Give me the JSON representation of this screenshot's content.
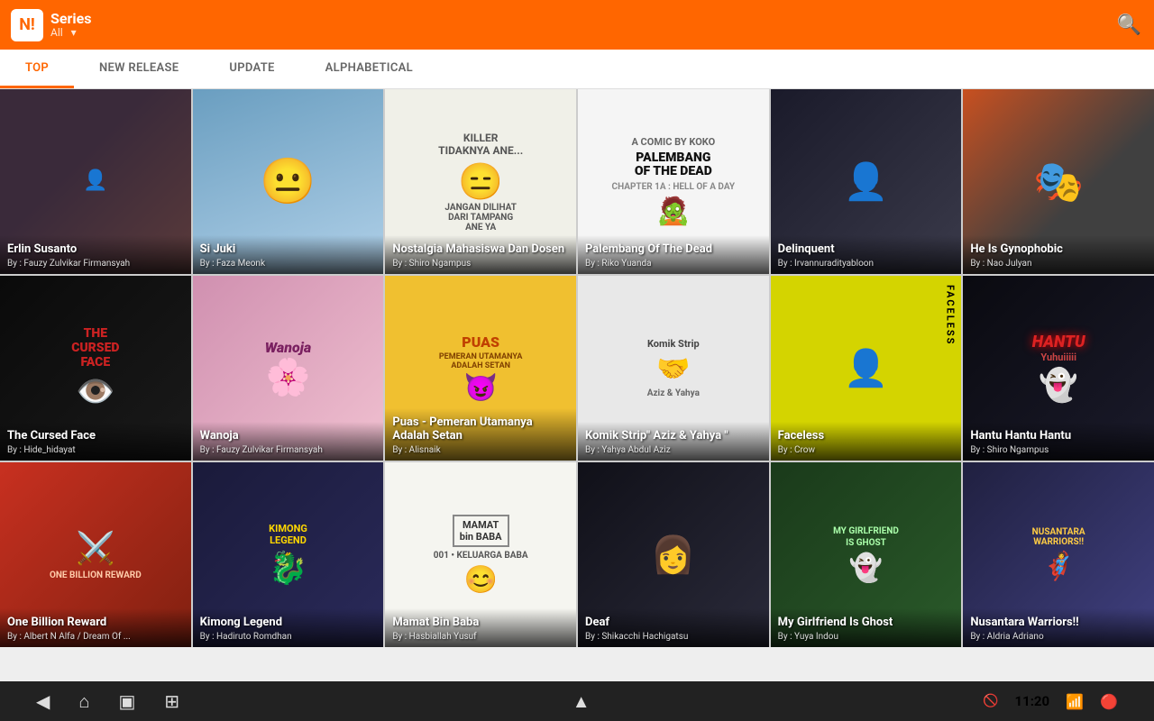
{
  "header": {
    "logo": "N!",
    "series_label": "Series",
    "all_label": "All"
  },
  "tabs": [
    {
      "label": "TOP",
      "active": true
    },
    {
      "label": "NEW RELEASE",
      "active": false
    },
    {
      "label": "UPDATE",
      "active": false
    },
    {
      "label": "ALPHABETICAL",
      "active": false
    }
  ],
  "manga_grid": [
    {
      "row": 1,
      "items": [
        {
          "title": "Erlin Susanto",
          "author": "By : Fauzy Zulvikar Firmansyah",
          "theme": "card-erlin"
        },
        {
          "title": "Si Juki",
          "author": "By : Faza Meonk",
          "theme": "card-sijuki"
        },
        {
          "title": "Nostalgia Mahasiswa Dan Dosen",
          "author": "By : Shiro Ngampus",
          "theme": "card-nostalgia"
        },
        {
          "title": "Palembang Of The Dead",
          "author": "By : Riko Yuanda",
          "theme": "card-palembang"
        },
        {
          "title": "Delinquent",
          "author": "By : Irvannuradityabloon",
          "theme": "card-delinquent"
        },
        {
          "title": "He Is Gynophobic",
          "author": "By : Nao Julyan",
          "theme": "card-gynophobic"
        }
      ]
    },
    {
      "row": 2,
      "items": [
        {
          "title": "The Cursed Face",
          "author": "By : Hide_hidayat",
          "theme": "card-cursed"
        },
        {
          "title": "Wanoja",
          "author": "By : Fauzy Zulvikar Firmansyah",
          "theme": "card-wanoja"
        },
        {
          "title": "Puas - Pemeran Utamanya Adalah Setan",
          "author": "By : Alisnaik",
          "theme": "card-puas"
        },
        {
          "title": "Komik Strip\" Aziz & Yahya \"",
          "author": "By : Yahya Abdul Aziz",
          "theme": "card-komik"
        },
        {
          "title": "Faceless",
          "author": "By : Crow",
          "theme": "card-faceless"
        },
        {
          "title": "Hantu Hantu Hantu",
          "author": "By : Shiro Ngampus",
          "theme": "card-hantu"
        }
      ]
    },
    {
      "row": 3,
      "items": [
        {
          "title": "One Billion Reward",
          "author": "By : Albert N Alfa / Dream Of ...",
          "theme": "card-onebillion"
        },
        {
          "title": "Kimong Legend",
          "author": "By : Hadiruto Romdhan",
          "theme": "card-kimong"
        },
        {
          "title": "Mamat Bin Baba",
          "author": "By : Hasbiallah Yusuf",
          "theme": "card-mamat"
        },
        {
          "title": "Deaf",
          "author": "By : Shikacchi Hachigatsu",
          "theme": "card-deaf"
        },
        {
          "title": "My Girlfriend Is Ghost",
          "author": "By : Yuya Indou",
          "theme": "card-girlfriend"
        },
        {
          "title": "Nusantara Warriors!!",
          "author": "By : Aldria Adriano",
          "theme": "card-nusantara"
        }
      ]
    }
  ],
  "bottom_nav": {
    "back_icon": "◀",
    "home_icon": "⌂",
    "recents_icon": "▣",
    "menu_icon": "⊞",
    "up_icon": "▲",
    "time": "11:20",
    "wifi_icon": "WiFi",
    "battery_icon": "🔋"
  }
}
